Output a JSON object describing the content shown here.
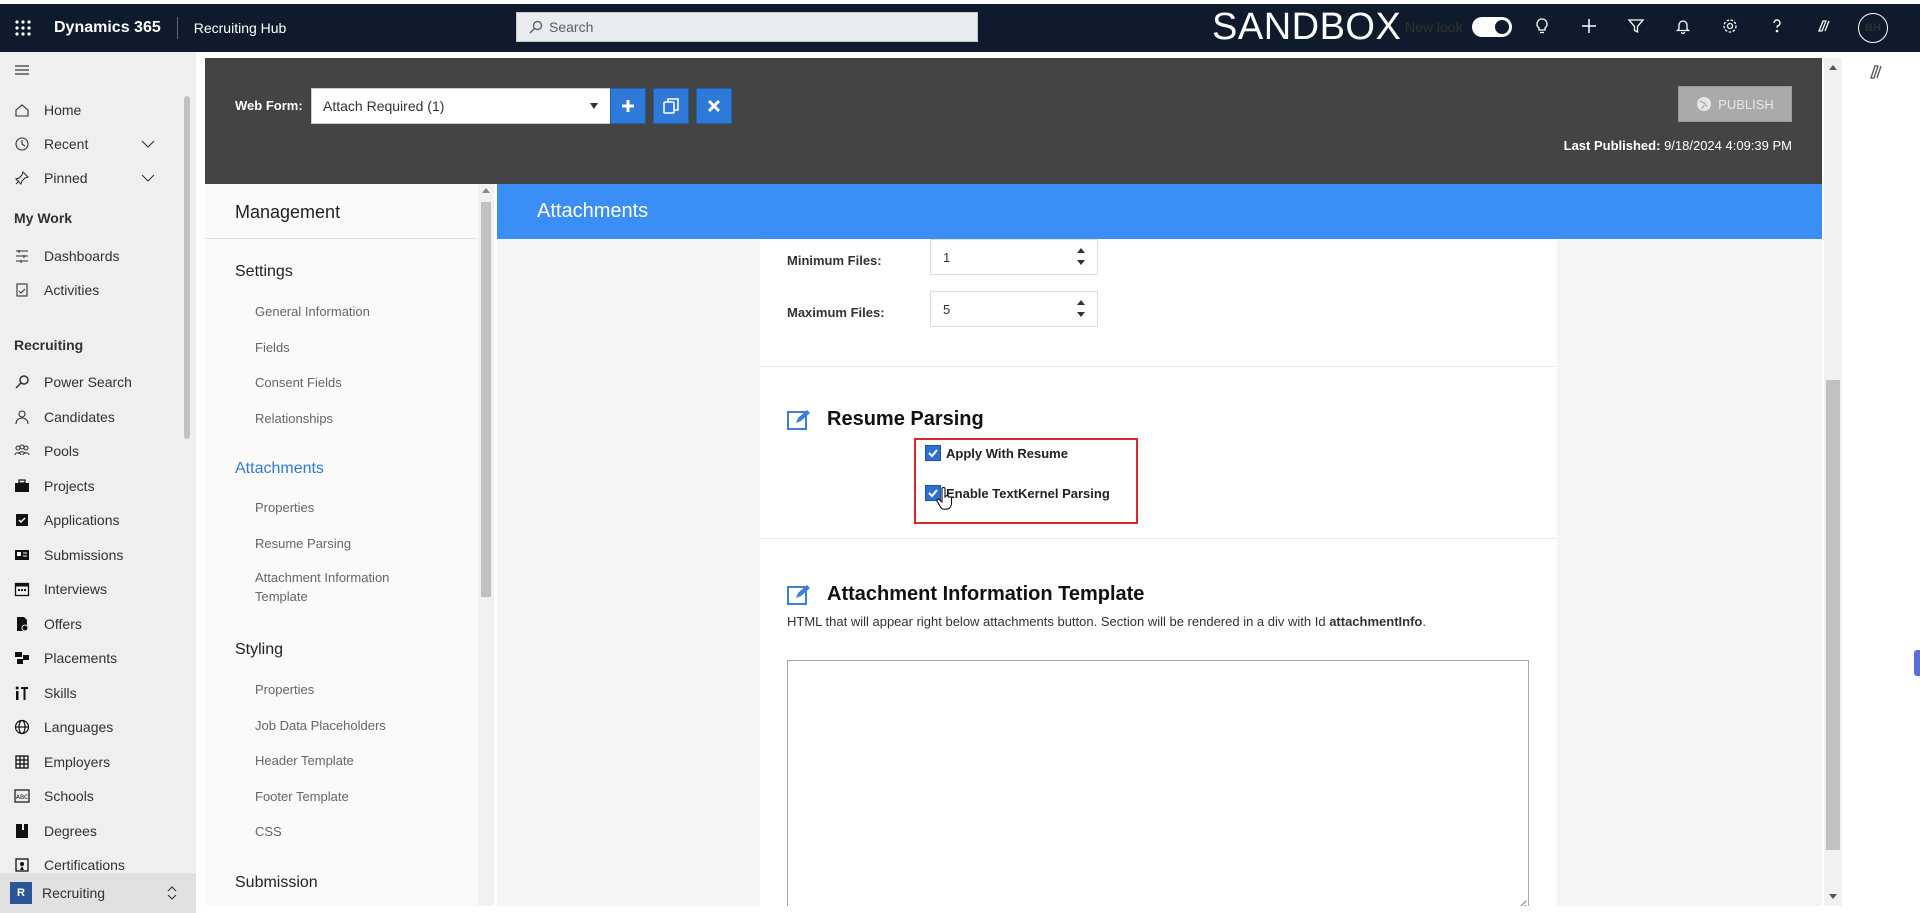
{
  "topbar": {
    "app_name": "Dynamics 365",
    "hub_name": "Recruiting Hub",
    "search_placeholder": "Search",
    "environment_label": "SANDBOX",
    "new_look_label": "New look",
    "new_look_on": true,
    "avatar_initials": "BH"
  },
  "sidenav": {
    "top_items": [
      {
        "label": "Home",
        "icon": "home-icon"
      },
      {
        "label": "Recent",
        "icon": "clock-icon"
      },
      {
        "label": "Pinned",
        "icon": "pin-icon"
      }
    ],
    "my_work_heading": "My Work",
    "my_work_items": [
      {
        "label": "Dashboards",
        "icon": "dashboard-icon"
      },
      {
        "label": "Activities",
        "icon": "clipboard-icon"
      }
    ],
    "recruiting_heading": "Recruiting",
    "recruiting_items": [
      {
        "label": "Power Search",
        "icon": "search-icon"
      },
      {
        "label": "Candidates",
        "icon": "person-icon"
      },
      {
        "label": "Pools",
        "icon": "group-icon"
      },
      {
        "label": "Projects",
        "icon": "briefcase-icon"
      },
      {
        "label": "Applications",
        "icon": "checkbox-icon"
      },
      {
        "label": "Submissions",
        "icon": "id-card-icon"
      },
      {
        "label": "Interviews",
        "icon": "calendar-icon"
      },
      {
        "label": "Offers",
        "icon": "document-icon"
      },
      {
        "label": "Placements",
        "icon": "placement-icon"
      },
      {
        "label": "Skills",
        "icon": "skills-icon"
      },
      {
        "label": "Languages",
        "icon": "globe-icon"
      },
      {
        "label": "Employers",
        "icon": "building-icon"
      },
      {
        "label": "Schools",
        "icon": "abc-icon"
      },
      {
        "label": "Degrees",
        "icon": "book-icon"
      },
      {
        "label": "Certifications",
        "icon": "certificate-icon"
      }
    ],
    "area_badge": "R",
    "area_label": "Recruiting"
  },
  "webform": {
    "label": "Web Form:",
    "selected": "Attach Required (1)",
    "publish_label": "PUBLISH",
    "last_published_label": "Last Published:",
    "last_published_value": "9/18/2024 4:09:39 PM"
  },
  "management": {
    "title": "Management",
    "groups": [
      {
        "label": "Settings",
        "links": [
          "General Information",
          "Fields",
          "Consent Fields",
          "Relationships"
        ]
      },
      {
        "label": "Attachments",
        "links": [
          "Properties",
          "Resume Parsing",
          "Attachment Information Template"
        ]
      },
      {
        "label": "Styling",
        "links": [
          "Properties",
          "Job Data Placeholders",
          "Header Template",
          "Footer Template",
          "CSS"
        ]
      },
      {
        "label": "Submission",
        "links": []
      }
    ]
  },
  "content": {
    "header": "Attachments",
    "min_files_label": "Minimum Files:",
    "min_files_value": "1",
    "max_files_label": "Maximum Files:",
    "max_files_value": "5",
    "resume_section_title": "Resume Parsing",
    "apply_with_resume_label": "Apply With Resume",
    "enable_parsing_label": "Enable TextKernel Parsing",
    "template_section_title": "Attachment Information Template",
    "template_desc_prefix": "HTML that will appear right below attachments button. Section will be rendered in a div with Id ",
    "template_desc_id": "attachmentInfo",
    "template_desc_suffix": "."
  },
  "colors": {
    "topbar_bg": "#0f1b2d",
    "accent_blue": "#3b8ef5",
    "highlight_red": "#e0242c"
  }
}
